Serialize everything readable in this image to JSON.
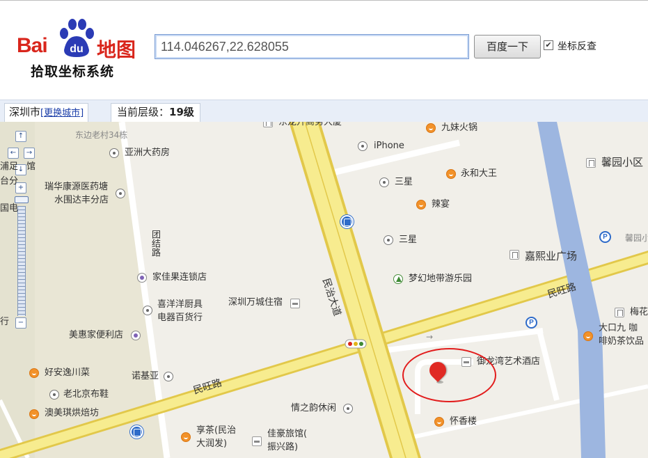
{
  "logo": {
    "text_bai": "Bai",
    "text_du": "du",
    "text_map": "地图",
    "subtitle": "拾取坐标系统",
    "brand_red": "#d9261c",
    "brand_blue": "#2b3bb5"
  },
  "search": {
    "value": "114.046267,22.628055",
    "button_label": "百度一下",
    "reverse_checked": true,
    "reverse_label": "坐标反查"
  },
  "info_bar": {
    "city": "深圳市",
    "change_city": "[更换城市]",
    "level_label": "当前层级：",
    "level_value": "19级"
  },
  "map_labels": {
    "dongbian": "东边老村34栋",
    "yazhou": "亚洲大药房",
    "ruihua1": "瑞华康源医药塘",
    "ruihua2": "水围达丰分店",
    "tuanjie": "团结路",
    "jiajiaguo": "家佳果连锁店",
    "xiyang1": "喜洋洋厨具",
    "xiyang2": "电器百货行",
    "meihui": "美惠家便利店",
    "haoan": "好安逸川菜",
    "laobeijing": "老北京布鞋",
    "aomei": "澳美琪烘焙坊",
    "nuojiya": "诺基亚",
    "minwang_w": "民旺路",
    "wancheng": "深圳万城住宿",
    "minzhi": "民治大道",
    "iphone": "iPhone",
    "sanxing1": "三星",
    "sanxing2": "三星",
    "jiumei": "九妹火锅",
    "yonghe": "永和大王",
    "layan": "辣宴",
    "mengmeng": "梦幻地带游乐园",
    "jiaxi": "嘉熙业广场",
    "minwang_e": "民旺路",
    "xinyuan": "馨园小区",
    "xinyuan_p": "馨园小",
    "meihua": "梅花",
    "dakou1": "大口九 咖",
    "dakou2": "啡奶茶饮品",
    "yulong": "御龙湾艺术酒店",
    "huaixiang": "怀香楼",
    "qingzhi": "情之韵休闲",
    "xiangcha1": "享茶(民治",
    "xiangcha2": "大润发)",
    "jiahao1": "佳豪旅馆(",
    "jiahao2": "振兴路)",
    "dongdragon": "东龙升商务大厦",
    "left1": "浦足",
    "left2": "馆",
    "left3": "台分",
    "left4": "国电",
    "left5": "行"
  },
  "nav": {
    "up": "↑",
    "left": "←",
    "right": "→",
    "down": "↓",
    "zoom_in": "+",
    "zoom_out": "−"
  },
  "colors": {
    "road_main": "#f7ec8f",
    "road_edge": "#e2c84a",
    "river": "#9db6e0",
    "land": "#f1efe9",
    "block": "#e9e6d5",
    "marker": "#e02a24",
    "circle": "#e21c1c"
  }
}
